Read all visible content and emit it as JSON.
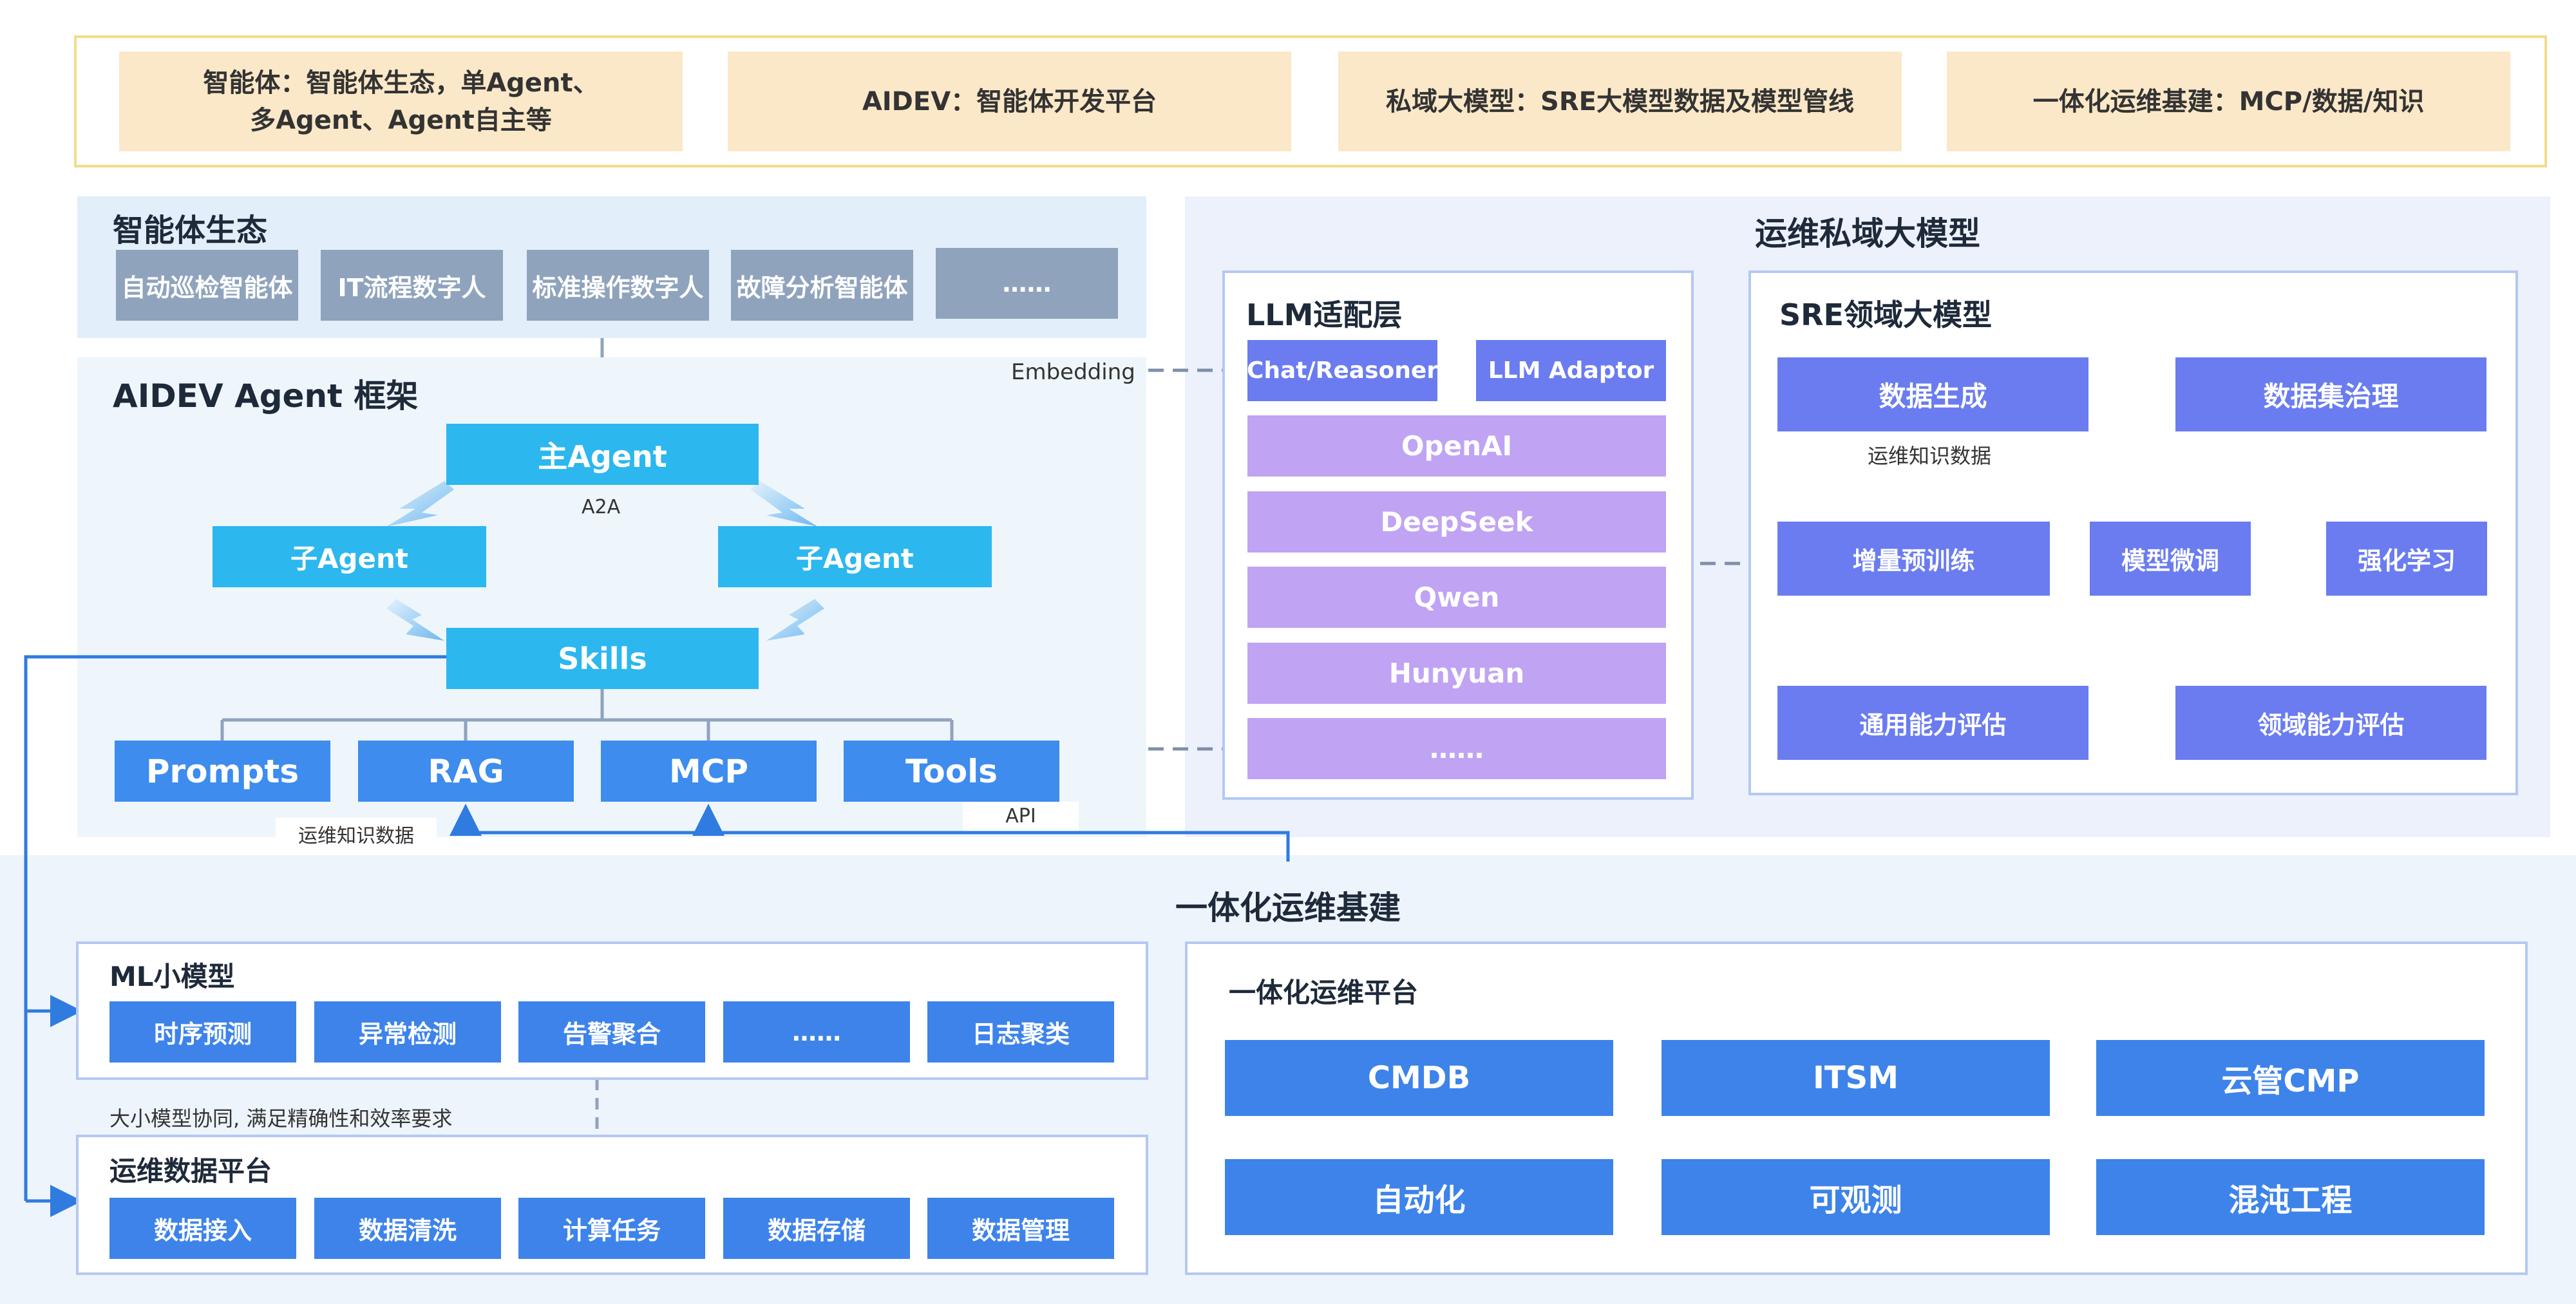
{
  "banner": [
    {
      "line1": "智能体：智能体生态，单Agent、",
      "line2": "多Agent、Agent自主等"
    },
    {
      "line1": "AIDEV：智能体开发平台",
      "line2": ""
    },
    {
      "line1": "私域大模型：SRE大模型数据及模型管线",
      "line2": ""
    },
    {
      "line1": "一体化运维基建：MCP/数据/知识",
      "line2": ""
    }
  ],
  "ecosystem": {
    "title": "智能体生态",
    "items": [
      "自动巡检智能体",
      "IT流程数字人",
      "标准操作数字人",
      "故障分析智能体",
      "……"
    ]
  },
  "aidev": {
    "title": "AIDEV Agent 框架",
    "main_agent": "主Agent",
    "a2a": "A2A",
    "sub_agent_left": "子Agent",
    "sub_agent_right": "子Agent",
    "skills": "Skills",
    "tools": [
      "Prompts",
      "RAG",
      "MCP",
      "Tools"
    ],
    "label_knowledge": "运维知识数据",
    "label_api": "API"
  },
  "connector": {
    "embedding": "Embedding"
  },
  "private_llm": {
    "title": "运维私域大模型",
    "llm_layer": {
      "title": "LLM适配层",
      "top": [
        "Chat/Reasoner",
        "LLM Adaptor"
      ],
      "models": [
        "OpenAI",
        "DeepSeek",
        "Qwen",
        "Hunyuan",
        "……"
      ]
    },
    "sre": {
      "title": "SRE领域大模型",
      "row1": [
        "数据生成",
        "数据集治理"
      ],
      "row1_note": "运维知识数据",
      "row2": [
        "增量预训练",
        "模型微调",
        "强化学习"
      ],
      "row3": [
        "通用能力评估",
        "领域能力评估"
      ]
    }
  },
  "infra": {
    "title": "一体化运维基建",
    "ml": {
      "title": "ML小模型",
      "items": [
        "时序预测",
        "异常检测",
        "告警聚合",
        "……",
        "日志聚类"
      ]
    },
    "ml_note": "大小模型协同, 满足精确性和效率要求",
    "data_platform": {
      "title": "运维数据平台",
      "items": [
        "数据接入",
        "数据清洗",
        "计算任务",
        "数据存储",
        "数据管理"
      ]
    },
    "ops_platform": {
      "title": "一体化运维平台",
      "items": [
        "CMDB",
        "ITSM",
        "云管CMP",
        "自动化",
        "可观测",
        "混沌工程"
      ]
    }
  },
  "colors": {
    "banner_border": "#f2dc8a",
    "banner_pill": "#fbe8c8",
    "agent_cyan": "#2cb7ef",
    "tool_blue": "#3d8cee",
    "sre_purple": "#6a7cf0",
    "llm_lavender": "#c0a3f3",
    "eco_grey": "#8fa3bd"
  }
}
